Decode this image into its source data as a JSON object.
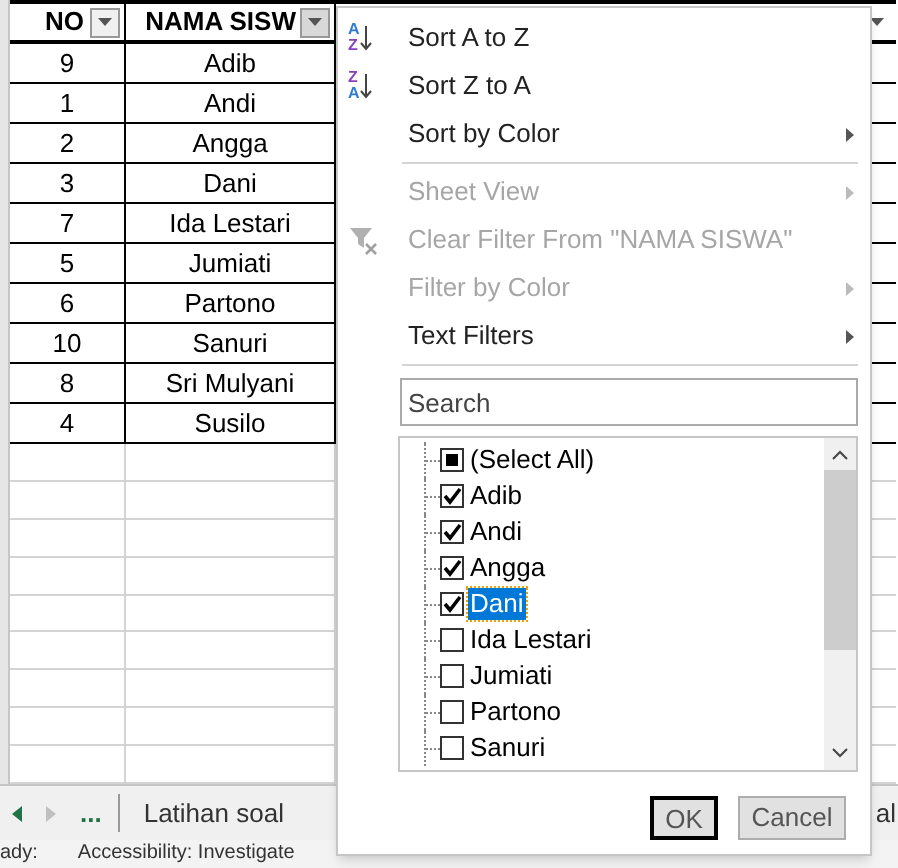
{
  "sheet": {
    "columns": [
      {
        "label": "NO"
      },
      {
        "label": "NAMA SISW"
      }
    ],
    "rows": [
      {
        "no": "9",
        "name": "Adib"
      },
      {
        "no": "1",
        "name": "Andi"
      },
      {
        "no": "2",
        "name": "Angga"
      },
      {
        "no": "3",
        "name": "Dani"
      },
      {
        "no": "7",
        "name": "Ida Lestari"
      },
      {
        "no": "5",
        "name": "Jumiati"
      },
      {
        "no": "6",
        "name": "Partono"
      },
      {
        "no": "10",
        "name": "Sanuri"
      },
      {
        "no": "8",
        "name": "Sri Mulyani"
      },
      {
        "no": "4",
        "name": "Susilo"
      }
    ]
  },
  "filter_menu": {
    "items": [
      {
        "kind": "sort",
        "icon_letters": [
          "A",
          "Z"
        ],
        "label": "Sort A to Z",
        "disabled": false
      },
      {
        "kind": "sort",
        "icon_letters": [
          "Z",
          "A"
        ],
        "label": "Sort Z to A",
        "disabled": false
      },
      {
        "kind": "submenu",
        "label": "Sort by Color",
        "disabled": false
      },
      {
        "kind": "separator"
      },
      {
        "kind": "submenu",
        "label": "Sheet View",
        "disabled": true
      },
      {
        "kind": "clear",
        "label": "Clear Filter From \"NAMA SISWA\"",
        "disabled": true
      },
      {
        "kind": "submenu",
        "label": "Filter by Color",
        "disabled": true
      },
      {
        "kind": "submenu",
        "label": "Text Filters",
        "disabled": false
      },
      {
        "kind": "separator"
      }
    ],
    "search": {
      "placeholder": "Search"
    },
    "values": [
      {
        "label": "(Select All)",
        "checked": true,
        "mixed": true,
        "selected": false
      },
      {
        "label": "Adib",
        "checked": true,
        "selected": false
      },
      {
        "label": "Andi",
        "checked": true,
        "selected": false
      },
      {
        "label": "Angga",
        "checked": true,
        "selected": false
      },
      {
        "label": "Dani",
        "checked": true,
        "selected": true
      },
      {
        "label": "Ida Lestari",
        "checked": false,
        "selected": false
      },
      {
        "label": "Jumiati",
        "checked": false,
        "selected": false
      },
      {
        "label": "Partono",
        "checked": false,
        "selected": false
      },
      {
        "label": "Sanuri",
        "checked": false,
        "selected": false
      }
    ],
    "buttons": [
      {
        "label": "OK",
        "default": true
      },
      {
        "label": "Cancel",
        "default": false
      }
    ]
  },
  "sheet_tabs": {
    "more": "...",
    "tabs": [
      {
        "label": "Latihan soal"
      },
      {
        "label": "al"
      }
    ]
  },
  "status_bar": [
    "ady:",
    "Accessibility: Investigate"
  ]
}
